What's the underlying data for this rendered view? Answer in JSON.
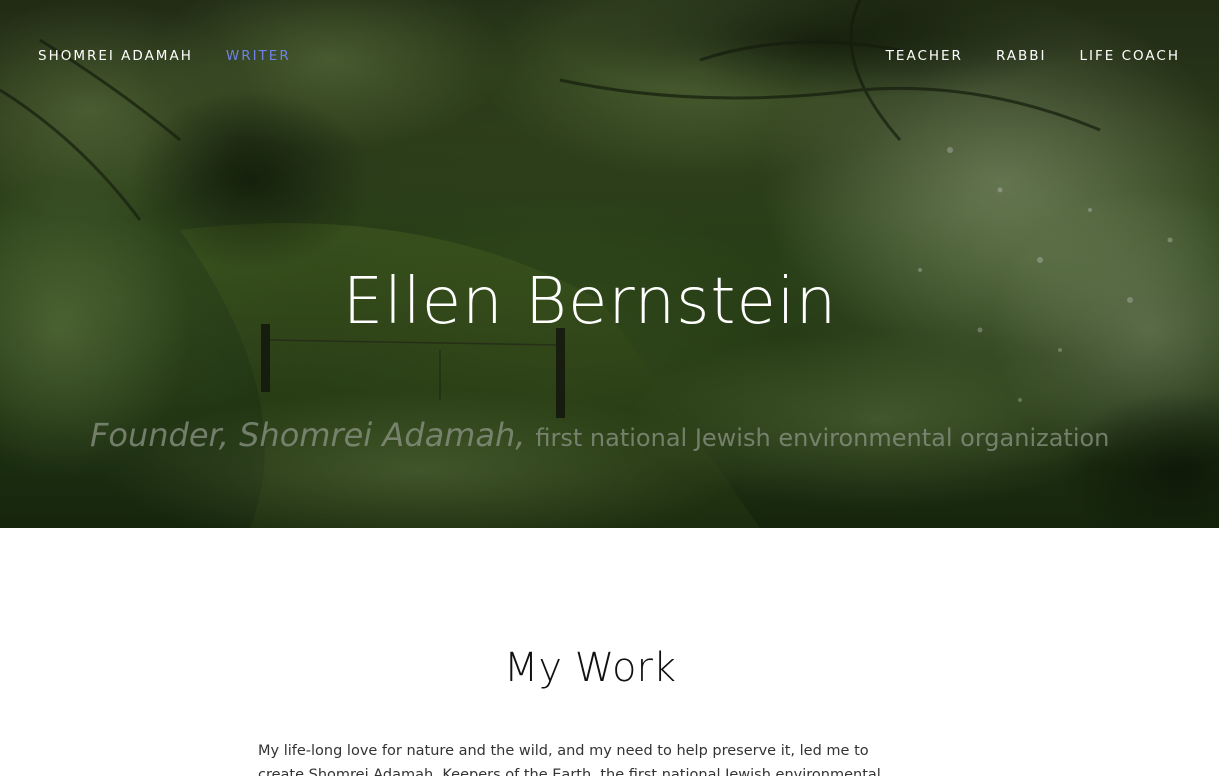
{
  "nav": {
    "left": [
      {
        "label": "SHOMREI ADAMAH",
        "active": false
      },
      {
        "label": "WRITER",
        "active": true
      }
    ],
    "right": [
      {
        "label": "TEACHER"
      },
      {
        "label": "RABBI"
      },
      {
        "label": "LIFE COACH"
      }
    ],
    "active_color": "#6f83e6"
  },
  "hero": {
    "title": "Ellen Bernstein",
    "subtitle_emphasis": "Founder, Shomrei Adamah,",
    "subtitle_rest": "first national Jewish environmental organization",
    "background": "forest-photo"
  },
  "section": {
    "title": "My Work",
    "body": "My life-long love for nature and the wild, and my need to help preserve it,  led me to create Shomrei Adamah, Keepers of the Earth, the first national Jewish environmental"
  }
}
